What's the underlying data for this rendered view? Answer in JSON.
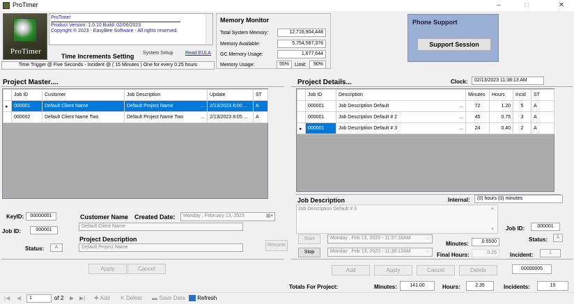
{
  "window": {
    "title": "ProTimer",
    "min": "–",
    "max": "□",
    "close": "✕"
  },
  "about": {
    "logo_text": "ProTimer",
    "app_name": "ProTimer",
    "version_line": "Product Version: 1.0.10   Build: 02/06/2023",
    "copyright_line": "Copyright ® 2023 - EasyBee Software - All rights reserved.",
    "time_increments_setting": "Time Increments Setting",
    "system_setup": "System Setup",
    "read_eula": "Read EULA",
    "trigger_text": "Time Trigger @ Five Seconds - Incident @ ( 15 Minutes ) One for every 0.25 hours"
  },
  "memory": {
    "title": "Memory Monitor",
    "total_label": "Total System Memory:",
    "total_value": "12,716,904,448",
    "available_label": "Memory Available:",
    "available_value": "5,754,597,376",
    "gc_label": "GC.Memory Usage:",
    "gc_value": "1,677,644",
    "usage_label": "Memory Usage:",
    "usage_value": "55%",
    "limit_label": "Limit:",
    "limit_value": "90%"
  },
  "phone": {
    "title": "Phone Support",
    "button": "Support Session"
  },
  "project_master": {
    "title": "Project Master....",
    "columns": [
      "Job ID",
      "Customer",
      "Job Description",
      "Update",
      "ST"
    ],
    "rows": [
      [
        "000001",
        "Default Client Name",
        "Default Project Name",
        "2/13/2023 8:00 ...",
        "A"
      ],
      [
        "000002",
        "Default Client Name Two",
        "Default Project Name Two",
        "2/13/2023 8:05 ...",
        "A"
      ]
    ]
  },
  "project_details": {
    "title": "Project Details...",
    "clock_label": "Clock:",
    "clock_value": "02/13/2023 11:38:13 AM",
    "columns": [
      "Job ID",
      "Description",
      "Minutes",
      "Hours",
      "Incid",
      "ST"
    ],
    "rows": [
      [
        "000001",
        "Job Description Default",
        "72",
        "1.20",
        "5",
        "A"
      ],
      [
        "000001",
        "Job Description Default # 2",
        "45",
        "0.75",
        "3",
        "A"
      ],
      [
        "000001",
        "Job Description Default # 3",
        "24",
        "0.40",
        "2",
        "A"
      ]
    ]
  },
  "form_left": {
    "keyid_label": "KeyID:",
    "keyid_value": "00000001",
    "customer_name_label": "Customer Name",
    "created_date_label": "Created Date:",
    "created_date_value": "Monday   ,  February  13, 2023",
    "customer_name_value": "Default Client Name",
    "jobid_label": "Job ID:",
    "jobid_value": "000001",
    "project_desc_label": "Project Description",
    "project_desc_value": "Default Project Name",
    "status_label": "Status:",
    "status_value": "A",
    "resume": "Resume",
    "apply": "Apply",
    "cancel": "Cancel"
  },
  "form_right": {
    "job_desc_label": "Job Description",
    "internal_label": "Internal:",
    "internal_value": "(0) hours (0) minutes",
    "job_desc_value": "Job Description Default # 3",
    "jobid_label": "Job ID:",
    "jobid_value": "000001",
    "status_label": "Status:",
    "status_value": "A",
    "start": "Start",
    "start_time": "Monday   , Feb 13, 2023 - 11:37:18AM",
    "stop": "Stop",
    "stop_time": "Monday   , Feb 13, 2023 - 11:38:13AM",
    "minutes_label": "Minutes:",
    "minutes_value": "0.5500",
    "final_hours_label": "Final Hours:",
    "final_hours_value": "0.25",
    "incident_label": "Incident:",
    "incident_value": "1",
    "add": "Add",
    "apply": "Apply",
    "cancel": "Cancel",
    "delete": "Delete",
    "record_id": "00000005"
  },
  "totals": {
    "label": "Totals For Project:",
    "minutes_label": "Minutes:",
    "minutes_value": "141.00",
    "hours_label": "Hours:",
    "hours_value": "2.35",
    "incidents_label": "Incidents:",
    "incidents_value": "10"
  },
  "navigator": {
    "first": "|◀",
    "prev": "◀",
    "position": "1",
    "of": "of 2",
    "next": "▶",
    "last": "▶|",
    "add": "Add",
    "delete": "Delete",
    "save": "Save Data",
    "refresh": "Refresh"
  }
}
